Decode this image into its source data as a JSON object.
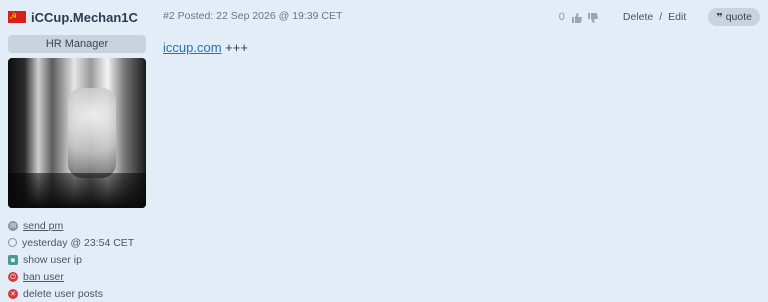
{
  "author": {
    "name": "iCCup.Mechan1C",
    "role": "HR Manager",
    "flag_symbol": "☭",
    "flag_color": "#d6211a"
  },
  "post": {
    "number": "#2",
    "posted_label": "Posted:",
    "date": "22 Sep 2026 @ 19:39 CET",
    "link_text": "iccup.com",
    "trailing_text": "+++"
  },
  "rating": {
    "count": "0",
    "thumbs_up_icon": "thumbs-up-icon",
    "thumbs_down_icon": "thumbs-down-icon"
  },
  "admin_actions": {
    "delete": "Delete",
    "separator": "/",
    "edit": "Edit"
  },
  "quote": {
    "icon": "❞",
    "label": "quote"
  },
  "user_actions": [
    {
      "label": "send pm",
      "icon": "message-icon"
    },
    {
      "label": "yesterday @ 23:54 CET",
      "icon": "clock-icon"
    },
    {
      "label": "show user ip",
      "icon": "ip-icon"
    },
    {
      "label": "ban user",
      "icon": "power-icon"
    },
    {
      "label": "delete user posts",
      "icon": "delete-icon"
    }
  ]
}
